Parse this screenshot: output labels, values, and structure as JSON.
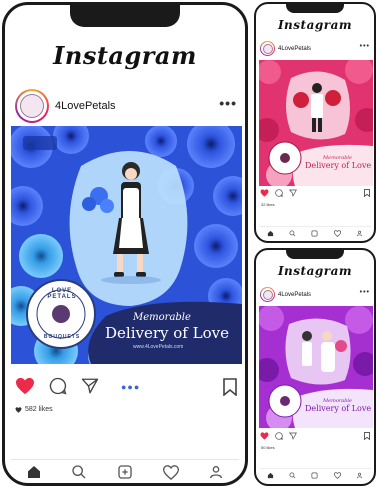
{
  "app": {
    "brand": "Instagram"
  },
  "account": {
    "username": "4LovePetals"
  },
  "post": {
    "tagline": "Memorable",
    "headline": "Delivery of Love",
    "badge_brand": "LOVE PETALS",
    "badge_sub": "BOUQUETS",
    "likes": "582 likes",
    "url": "www.4LovePetals.com"
  },
  "thumbs": [
    {
      "likes": "32 likes"
    },
    {
      "likes": "50 likes"
    }
  ],
  "colors": {
    "heart": "#ed2a4a",
    "main_post_bg": "#2a4fd6",
    "banner_navy": "#1f2b6b",
    "thumb1_bg": "#e0336f",
    "thumb2_bg": "#a52fd0"
  }
}
